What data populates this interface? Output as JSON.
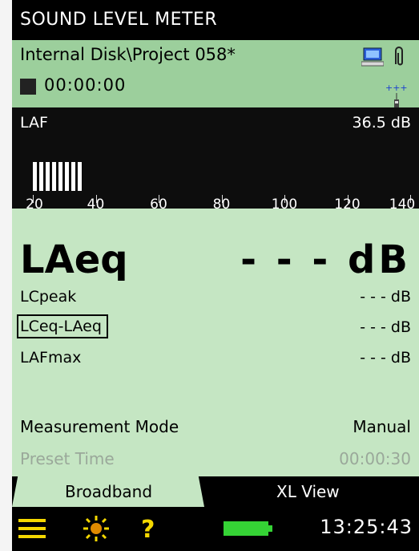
{
  "app": {
    "title": "SOUND LEVEL METER"
  },
  "status": {
    "path": "Internal Disk\\Project 058*",
    "elapsed": "00:00:00",
    "pc_icon": "computer-icon",
    "clip_icon": "paperclip-icon",
    "usb_icon": "usb-connected-icon"
  },
  "meter": {
    "label": "LAF",
    "reading": "36.5 dB",
    "bar_level_db": 36.5,
    "scale_min": 20,
    "scale_max": 140,
    "scale_labels": [
      "20",
      "40",
      "60",
      "80",
      "100",
      "120",
      "140"
    ]
  },
  "main": {
    "primary": {
      "name": "LAeq",
      "value": "- - -  dB"
    },
    "rows": [
      {
        "name": "LCpeak",
        "value": "- - - dB"
      },
      {
        "name": "LCeq-LAeq",
        "value": "- - - dB",
        "selected": true
      },
      {
        "name": "LAFmax",
        "value": "- - - dB"
      }
    ],
    "measurement_mode": {
      "label": "Measurement Mode",
      "value": "Manual"
    },
    "preset_time": {
      "label": "Preset Time",
      "value": "00:00:30"
    }
  },
  "tabs": [
    {
      "label": "Broadband",
      "active": true
    },
    {
      "label": "XL View",
      "active": false
    }
  ],
  "bottom_bar": {
    "icons": [
      "menu-icon",
      "backlight-icon",
      "help-icon",
      "battery-icon"
    ],
    "time": "13:25:43"
  },
  "colors": {
    "background": "#c5e6c3",
    "info_bar": "#9ccf9c",
    "accent_yellow": "#f5d800",
    "battery_green": "#35d335"
  }
}
